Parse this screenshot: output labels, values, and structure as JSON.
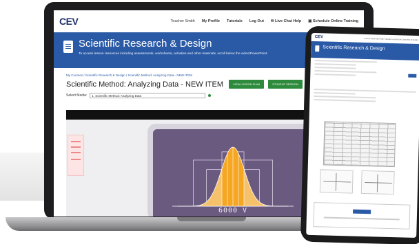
{
  "laptop": {
    "logo": "CEV",
    "nav": {
      "user": "Teacher Smith",
      "profile": "My Profile",
      "tutorials": "Tutorials",
      "logout": "Log Out",
      "live_chat": "Live Chat Help",
      "schedule": "Schedule Online Training"
    },
    "course_title": "Scientific Research & Design",
    "course_subtitle": "To access lesson resources including assessments, worksheets, activities and other materials, scroll below the video/PowerPoint.",
    "breadcrumb": "My Courses  /  Scientific Research & Design  /  Scientific Method: Analyzing Data - NEW ITEM",
    "item_title": "Scientific Method: Analyzing Data - NEW ITEM",
    "buttons": {
      "view_lessonplan": "VIEW LESSON PLAN",
      "student_session": "STUDENT SESSION"
    },
    "media": {
      "label": "Select Media:",
      "value": "1. Scientific Method: Analyzing Data"
    },
    "video": {
      "monitor_text": "6000 V"
    }
  },
  "tablet": {
    "logo": "CEV",
    "nav_text": "Teacher Smith  My Profile  Tutorials  Log Out  Live Chat Help  Schedule",
    "course_title": "Scientific Research & Design"
  },
  "colors": {
    "header_blue": "#2a5aa6",
    "button_green": "#2e8b3d",
    "curve_orange": "#f5a623",
    "monitor_purple": "#6b5a80"
  },
  "chart_data": {
    "type": "area",
    "title": "",
    "xlabel": "",
    "ylabel": "",
    "series": [
      {
        "values": [
          0.01,
          0.05,
          0.18,
          0.45,
          0.8,
          1.0,
          0.8,
          0.45,
          0.18,
          0.05,
          0.01
        ]
      }
    ],
    "x": [
      -5,
      -4,
      -3,
      -2,
      -1,
      0,
      1,
      2,
      3,
      4,
      5
    ],
    "highlight_range": [
      -1,
      1
    ]
  }
}
